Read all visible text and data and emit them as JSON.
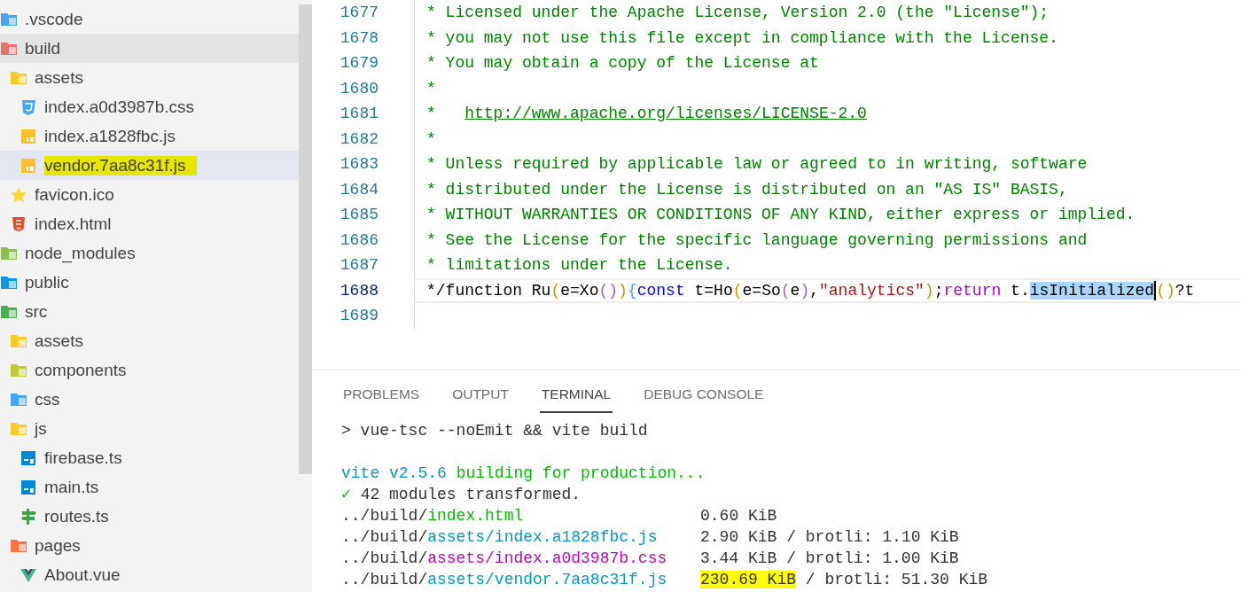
{
  "explorer": {
    "items": [
      {
        "label": ".vscode",
        "kind": "folder",
        "color": "#42a5f5",
        "selected": false,
        "hovered": false,
        "marked": false
      },
      {
        "label": "build",
        "kind": "folder",
        "color": "#e57373",
        "selected": false,
        "hovered": true,
        "marked": false,
        "children": [
          {
            "label": "assets",
            "kind": "folder",
            "color": "#ffca28",
            "selected": false,
            "hovered": false,
            "marked": false,
            "children": [
              {
                "label": "index.a0d3987b.css",
                "kind": "css",
                "selected": false,
                "hovered": false,
                "marked": false
              },
              {
                "label": "index.a1828fbc.js",
                "kind": "js",
                "selected": false,
                "hovered": false,
                "marked": false
              },
              {
                "label": "vendor.7aa8c31f.js",
                "kind": "js",
                "selected": true,
                "hovered": false,
                "marked": true
              }
            ]
          },
          {
            "label": "favicon.ico",
            "kind": "star",
            "selected": false,
            "hovered": false,
            "marked": false
          },
          {
            "label": "index.html",
            "kind": "html",
            "selected": false,
            "hovered": false,
            "marked": false
          }
        ]
      },
      {
        "label": "node_modules",
        "kind": "folder",
        "color": "#8bc34a",
        "selected": false,
        "hovered": false,
        "marked": false
      },
      {
        "label": "public",
        "kind": "folder",
        "color": "#039be5",
        "selected": false,
        "hovered": false,
        "marked": false
      },
      {
        "label": "src",
        "kind": "folder",
        "color": "#4caf50",
        "selected": false,
        "hovered": false,
        "marked": false,
        "children": [
          {
            "label": "assets",
            "kind": "folder",
            "color": "#ffca28",
            "selected": false,
            "hovered": false,
            "marked": false
          },
          {
            "label": "components",
            "kind": "folder",
            "color": "#c0ca33",
            "selected": false,
            "hovered": false,
            "marked": false
          },
          {
            "label": "css",
            "kind": "folder",
            "color": "#42a5f5",
            "selected": false,
            "hovered": false,
            "marked": false
          },
          {
            "label": "js",
            "kind": "folder",
            "color": "#ffca28",
            "selected": false,
            "hovered": false,
            "marked": false,
            "children": [
              {
                "label": "firebase.ts",
                "kind": "ts",
                "selected": false,
                "hovered": false,
                "marked": false
              },
              {
                "label": "main.ts",
                "kind": "ts",
                "selected": false,
                "hovered": false,
                "marked": false
              },
              {
                "label": "routes.ts",
                "kind": "routes",
                "selected": false,
                "hovered": false,
                "marked": false
              }
            ]
          },
          {
            "label": "pages",
            "kind": "folder",
            "color": "#ff7043",
            "selected": false,
            "hovered": false,
            "marked": false,
            "children": [
              {
                "label": "About.vue",
                "kind": "vue",
                "selected": false,
                "hovered": false,
                "marked": false
              }
            ]
          }
        ]
      }
    ]
  },
  "editor": {
    "lines": [
      {
        "number": "1677",
        "current": false,
        "tokens": [
          {
            "text": "* Licensed under the Apache License, Version 2.0 (the \"License\");",
            "color": "#008000",
            "kind": "text",
            "selected": false
          }
        ]
      },
      {
        "number": "1678",
        "current": false,
        "tokens": [
          {
            "text": "* you may not use this file except in compliance with the License.",
            "color": "#008000",
            "kind": "text",
            "selected": false
          }
        ]
      },
      {
        "number": "1679",
        "current": false,
        "tokens": [
          {
            "text": "* You may obtain a copy of the License at",
            "color": "#008000",
            "kind": "text",
            "selected": false
          }
        ]
      },
      {
        "number": "1680",
        "current": false,
        "tokens": [
          {
            "text": "*",
            "color": "#008000",
            "kind": "text",
            "selected": false
          }
        ]
      },
      {
        "number": "1681",
        "current": false,
        "tokens": [
          {
            "text": "*   ",
            "color": "#008000",
            "kind": "text",
            "selected": false
          },
          {
            "text": "http://www.apache.org/licenses/LICENSE-2.0",
            "color": "#008000",
            "kind": "link",
            "selected": false
          }
        ]
      },
      {
        "number": "1682",
        "current": false,
        "tokens": [
          {
            "text": "*",
            "color": "#008000",
            "kind": "text",
            "selected": false
          }
        ]
      },
      {
        "number": "1683",
        "current": false,
        "tokens": [
          {
            "text": "* Unless required by applicable law or agreed to in writing, software",
            "color": "#008000",
            "kind": "text",
            "selected": false
          }
        ]
      },
      {
        "number": "1684",
        "current": false,
        "tokens": [
          {
            "text": "* distributed under the License is distributed on an \"AS IS\" BASIS,",
            "color": "#008000",
            "kind": "text",
            "selected": false
          }
        ]
      },
      {
        "number": "1685",
        "current": false,
        "tokens": [
          {
            "text": "* WITHOUT WARRANTIES OR CONDITIONS OF ANY KIND, either express or implied.",
            "color": "#008000",
            "kind": "text",
            "selected": false
          }
        ]
      },
      {
        "number": "1686",
        "current": false,
        "tokens": [
          {
            "text": "* See the License for the specific language governing permissions and",
            "color": "#008000",
            "kind": "text",
            "selected": false
          }
        ]
      },
      {
        "number": "1687",
        "current": false,
        "tokens": [
          {
            "text": "* limitations under the License.",
            "color": "#008000",
            "kind": "text",
            "selected": false
          }
        ]
      },
      {
        "number": "1688",
        "current": true,
        "tokens": [
          {
            "text": "*/function Ru",
            "color": "#000000",
            "kind": "text",
            "selected": false
          },
          {
            "text": "(",
            "color": "#c99400",
            "kind": "text",
            "selected": false
          },
          {
            "text": "e=Xo",
            "color": "#000000",
            "kind": "text",
            "selected": false
          },
          {
            "text": "()",
            "color": "#a05cd6",
            "kind": "text",
            "selected": false
          },
          {
            "text": ")",
            "color": "#c99400",
            "kind": "text",
            "selected": false
          },
          {
            "text": "{",
            "color": "#4f9cf0",
            "kind": "text",
            "selected": false
          },
          {
            "text": "const",
            "color": "#0000ff",
            "kind": "text",
            "selected": false
          },
          {
            "text": " t=Ho",
            "color": "#000000",
            "kind": "text",
            "selected": false
          },
          {
            "text": "(",
            "color": "#c99400",
            "kind": "text",
            "selected": false
          },
          {
            "text": "e=So",
            "color": "#000000",
            "kind": "text",
            "selected": false
          },
          {
            "text": "(",
            "color": "#a05cd6",
            "kind": "text",
            "selected": false
          },
          {
            "text": "e",
            "color": "#000000",
            "kind": "text",
            "selected": false
          },
          {
            "text": ")",
            "color": "#a05cd6",
            "kind": "text",
            "selected": false
          },
          {
            "text": ",",
            "color": "#000000",
            "kind": "text",
            "selected": false
          },
          {
            "text": "\"analytics\"",
            "color": "#a31515",
            "kind": "text",
            "selected": false
          },
          {
            "text": ")",
            "color": "#c99400",
            "kind": "text",
            "selected": false
          },
          {
            "text": ";",
            "color": "#000000",
            "kind": "text",
            "selected": false
          },
          {
            "text": "return",
            "color": "#af00db",
            "kind": "text",
            "selected": false
          },
          {
            "text": " t.",
            "color": "#000000",
            "kind": "text",
            "selected": false
          },
          {
            "text": "isInitialized",
            "color": "#000000",
            "kind": "text",
            "selected": true
          },
          {
            "text": "()",
            "color": "#c99400",
            "kind": "cursor",
            "selected": false
          },
          {
            "text": "?t",
            "color": "#000000",
            "kind": "text",
            "selected": false
          }
        ]
      },
      {
        "number": "1689",
        "current": false
      }
    ]
  },
  "panel": {
    "tabs": [
      {
        "label": "PROBLEMS",
        "selected": false
      },
      {
        "label": "OUTPUT",
        "selected": false
      },
      {
        "label": "TERMINAL",
        "selected": true
      },
      {
        "label": "DEBUG CONSOLE",
        "selected": false
      }
    ],
    "terminal": {
      "lines": [
        {
          "kind": "command",
          "segments": [
            {
              "text": "> vue-tsc --noEmit && vite build",
              "color": "#333333"
            }
          ]
        },
        {
          "kind": "output",
          "segments": [
            {
              "text": "vite v2.5.6 ",
              "color": "#0598bc"
            },
            {
              "text": "building for production...",
              "color": "#00bc00"
            }
          ]
        },
        {
          "kind": "output",
          "segments": [
            {
              "text": "✓",
              "color": "#00bc00"
            },
            {
              "text": " 42 modules transformed.",
              "color": "#333333"
            }
          ]
        }
      ],
      "files": [
        {
          "path": [
            {
              "text": "../build/",
              "color": "#333333"
            },
            {
              "text": "index.html",
              "color": "#00bc00"
            }
          ],
          "size": [
            {
              "text": "0.60 KiB",
              "marked": false
            }
          ]
        },
        {
          "path": [
            {
              "text": "../build/",
              "color": "#333333"
            },
            {
              "text": "assets/index.a1828fbc.js",
              "color": "#0598bc"
            }
          ],
          "size": [
            {
              "text": "2.90 KiB / brotli: 1.10 KiB",
              "marked": false
            }
          ]
        },
        {
          "path": [
            {
              "text": "../build/",
              "color": "#333333"
            },
            {
              "text": "assets/index.a0d3987b.css",
              "color": "#bc05bc"
            }
          ],
          "size": [
            {
              "text": "3.44 KiB / brotli: 1.00 KiB",
              "marked": false
            }
          ]
        },
        {
          "path": [
            {
              "text": "../build/",
              "color": "#333333"
            },
            {
              "text": "assets/vendor.7aa8c31f.js",
              "color": "#0598bc"
            }
          ],
          "size": [
            {
              "text": "230.69 KiB",
              "marked": true
            },
            {
              "text": " / brotli: 51.30 KiB",
              "marked": false
            }
          ]
        }
      ]
    }
  }
}
